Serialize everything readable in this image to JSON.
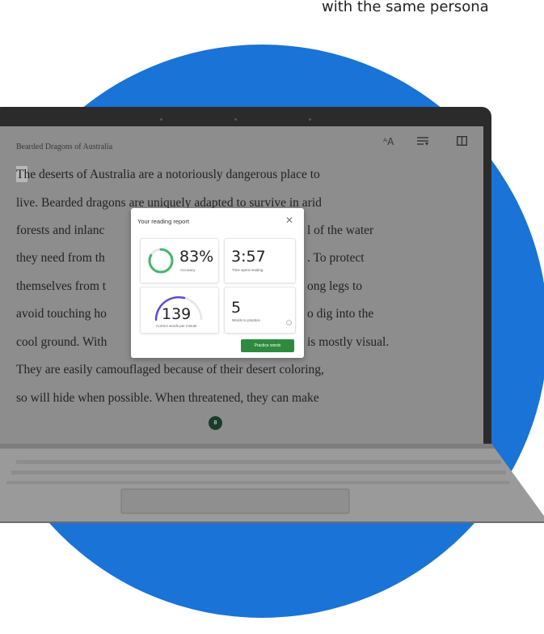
{
  "caption": {
    "text": "with the same persona"
  },
  "reader": {
    "doc_title": "Bearded Dragons of Australia",
    "lines": [
      "The deserts of Australia are a notoriously dangerous place to",
      "live. Bearded dragons are uniquely adapted to survive in arid",
      "forests and inlanc",
      "they need from th",
      "themselves from t",
      "avoid touching ho",
      "cool ground. With",
      "They are easily camouflaged because of their desert coloring,",
      "so will hide when possible. When threatened, they can make"
    ],
    "lines_right": [
      "l of the water",
      ". To protect",
      "ong legs to",
      "o dig into the",
      "is mostly visual."
    ],
    "page_number": "8",
    "toolbar_icons": [
      "text-size-icon",
      "line-focus-icon",
      "reader-view-icon"
    ]
  },
  "report": {
    "title": "Your reading report",
    "accuracy": {
      "value": "83%",
      "label": "Accuracy",
      "fraction": 0.83
    },
    "time": {
      "value": "3:57",
      "label": "Time spent reading"
    },
    "wpm": {
      "value": "139",
      "label": "Correct words per minute"
    },
    "words": {
      "value": "5",
      "label": "Words to practice"
    },
    "practice_button": "Practice words"
  },
  "colors": {
    "background_circle": "#1a73d6",
    "ring_green": "#46b56b",
    "wpm_arc": "#5b4bd6",
    "button_green": "#2e8a3e"
  }
}
